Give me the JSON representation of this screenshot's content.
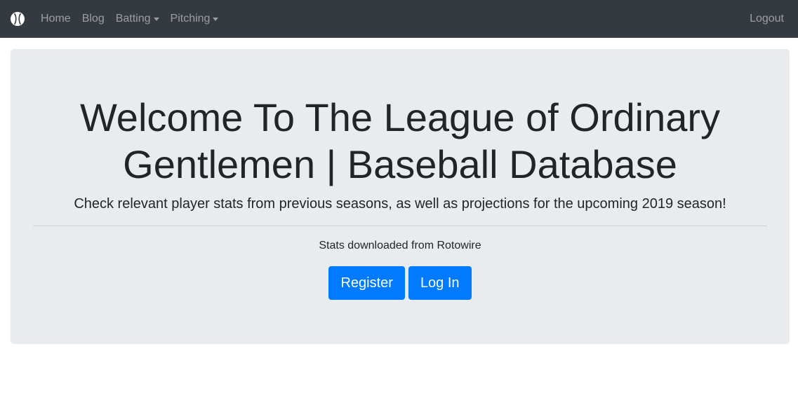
{
  "navbar": {
    "brand_icon": "baseball-icon",
    "links": [
      {
        "label": "Home"
      },
      {
        "label": "Blog"
      },
      {
        "label": "Batting"
      },
      {
        "label": "Pitching"
      }
    ],
    "logout_label": "Logout",
    "background_color": "#343a40"
  },
  "hero": {
    "title": "Welcome To The League of Ordinary Gentlemen | Baseball Database",
    "lead": "Check relevant player stats from previous seasons, as well as projections for the upcoming 2019 season!",
    "note": "Stats downloaded from Rotowire",
    "register_label": "Register",
    "login_label": "Log In",
    "background_color": "#e9ecef",
    "button_color": "#007bff"
  }
}
